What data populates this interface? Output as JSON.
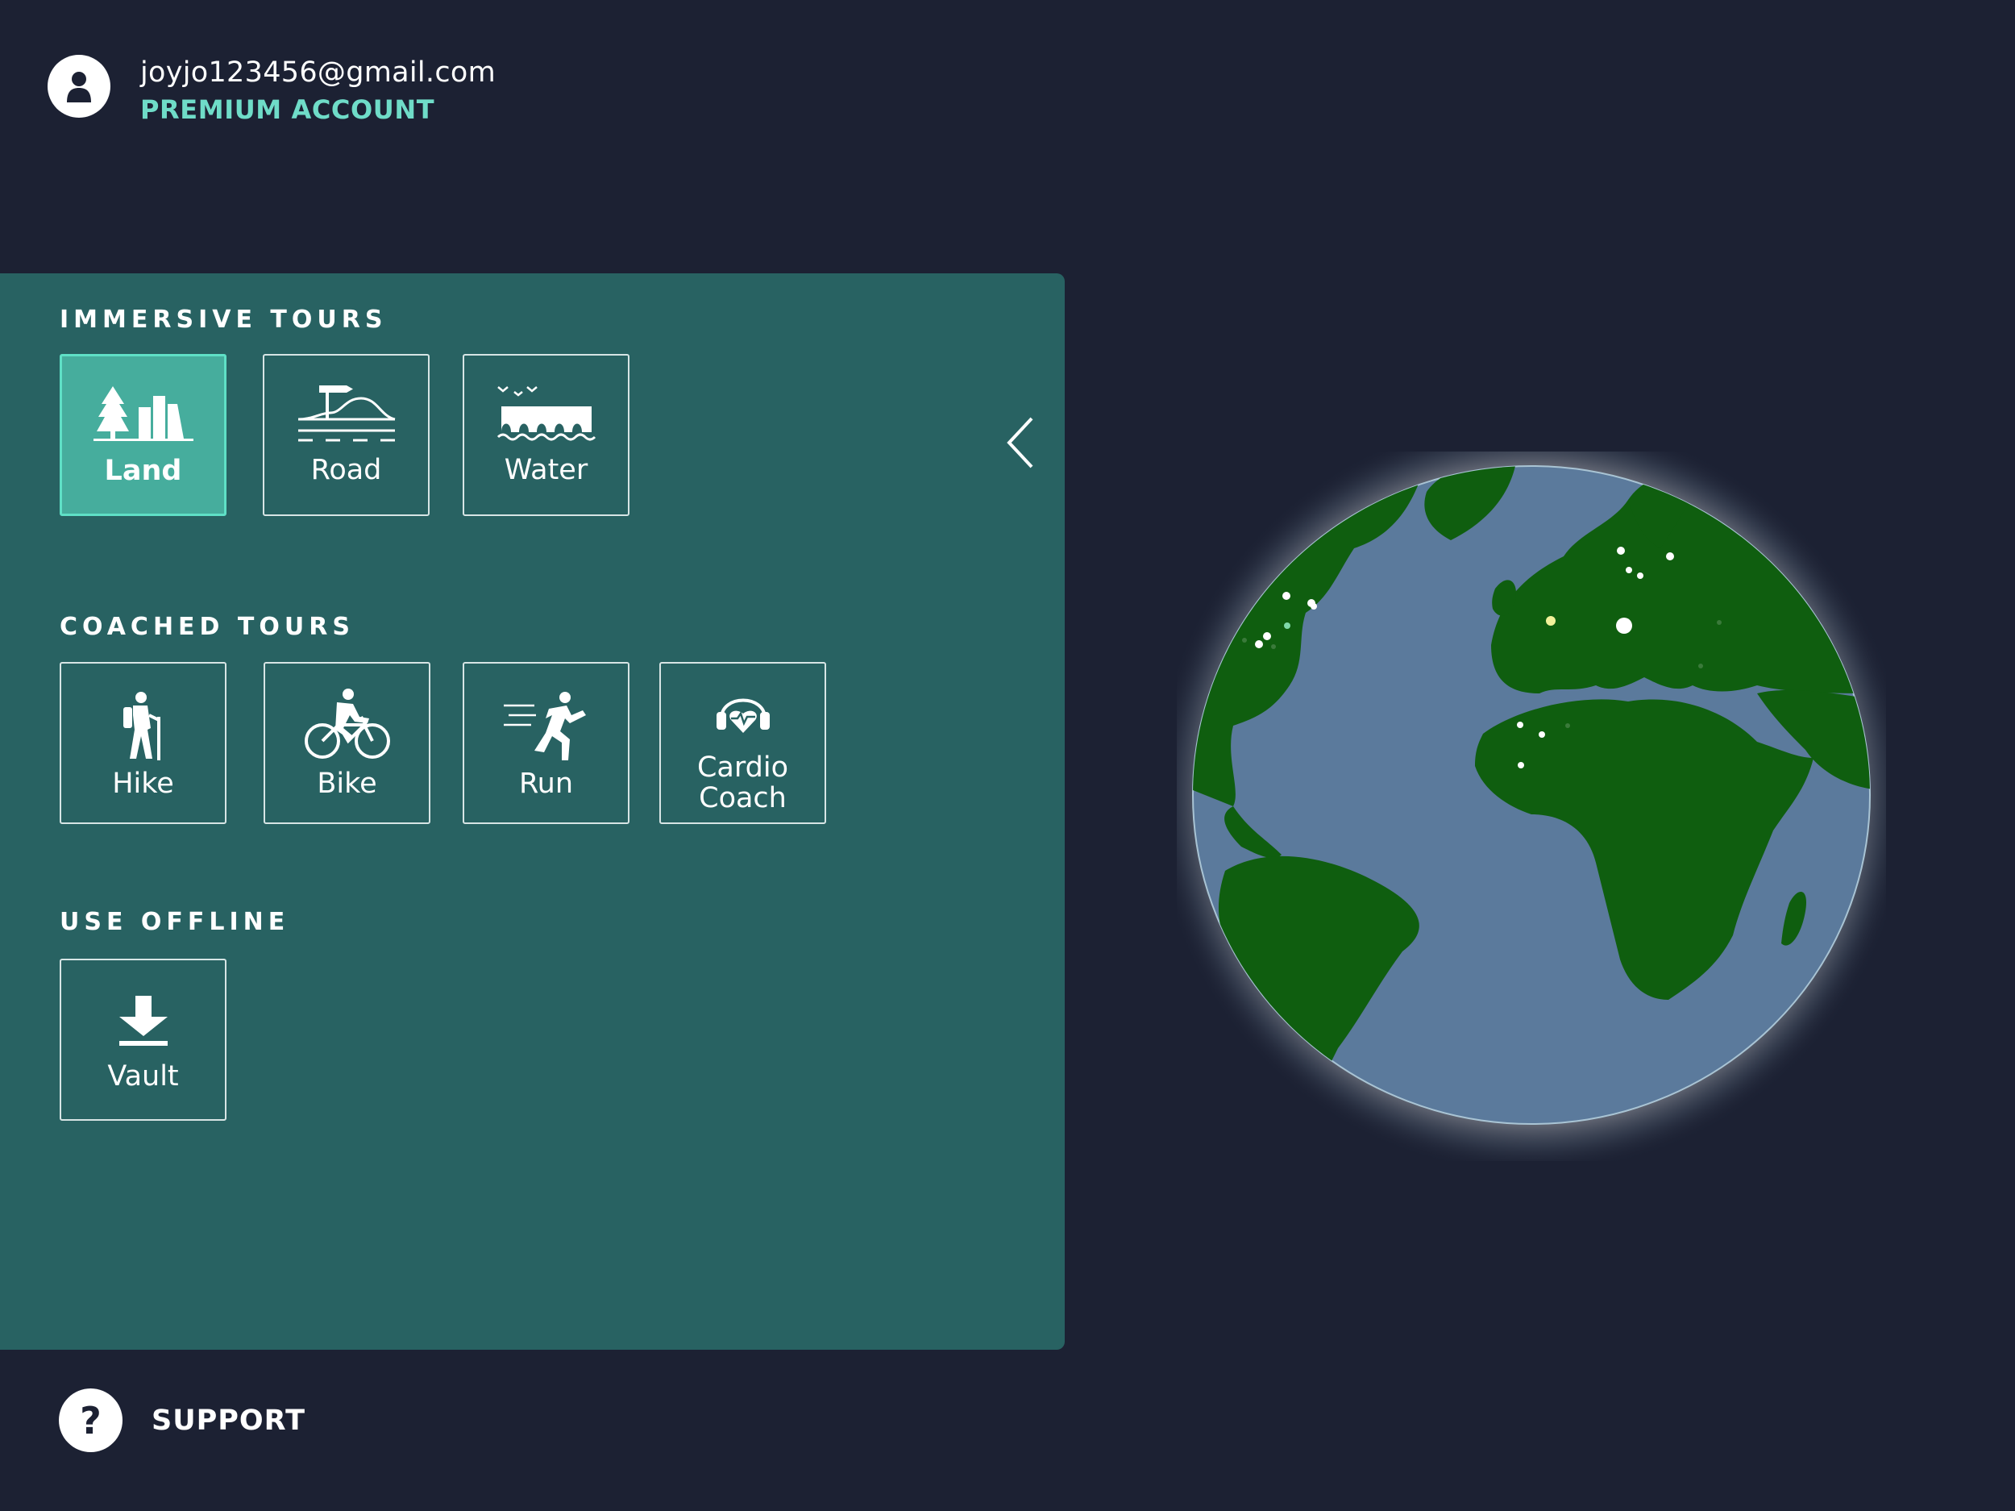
{
  "account": {
    "email": "joyjo123456@gmail.com",
    "plan": "PREMIUM ACCOUNT",
    "avatar_icon": "user-icon"
  },
  "immersive": {
    "title": "IMMERSIVE TOURS",
    "items": [
      {
        "label": "Land",
        "icon": "land-icon",
        "selected": true
      },
      {
        "label": "Road",
        "icon": "road-icon",
        "selected": false
      },
      {
        "label": "Water",
        "icon": "water-icon",
        "selected": false
      }
    ]
  },
  "coached": {
    "title": "COACHED TOURS",
    "items": [
      {
        "label": "Hike",
        "icon": "hike-icon"
      },
      {
        "label": "Bike",
        "icon": "bike-icon"
      },
      {
        "label": "Run",
        "icon": "run-icon"
      },
      {
        "label": "Cardio\nCoach",
        "icon": "cardio-coach-icon"
      }
    ]
  },
  "offline": {
    "title": "USE OFFLINE",
    "items": [
      {
        "label": "Vault",
        "icon": "download-icon"
      }
    ]
  },
  "support": {
    "label": "SUPPORT",
    "icon": "help-icon"
  },
  "colors": {
    "background": "#1c2133",
    "panel": "#286262",
    "accent": "#6fdcc8",
    "active_tile": "#46ad9d",
    "ocean": "#5b7a9c",
    "land": "#0f5e0f"
  }
}
